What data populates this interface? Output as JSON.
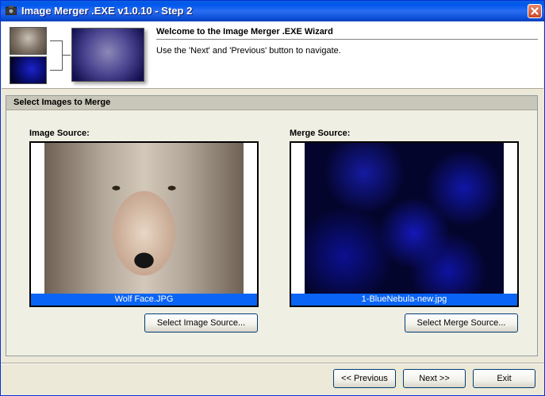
{
  "window": {
    "title": "Image Merger .EXE v1.0.10 - Step 2"
  },
  "header": {
    "title": "Welcome to the Image Merger .EXE Wizard",
    "subtitle": "Use the 'Next' and 'Previous' button to navigate."
  },
  "panel": {
    "title": "Select Images to Merge",
    "image_source": {
      "label": "Image Source:",
      "filename": "Wolf Face.JPG",
      "button_label": "Select Image Source..."
    },
    "merge_source": {
      "label": "Merge Source:",
      "filename": "1-BlueNebula-new.jpg",
      "button_label": "Select Merge Source..."
    }
  },
  "footer": {
    "previous_label": "<< Previous",
    "next_label": "Next >>",
    "exit_label": "Exit"
  },
  "colors": {
    "titlebar": "#0a5fe0",
    "selection_caption": "#0a64f5",
    "dialog_background": "#ece9d8"
  },
  "icons": {
    "app": "camera-icon",
    "close": "close-icon"
  }
}
